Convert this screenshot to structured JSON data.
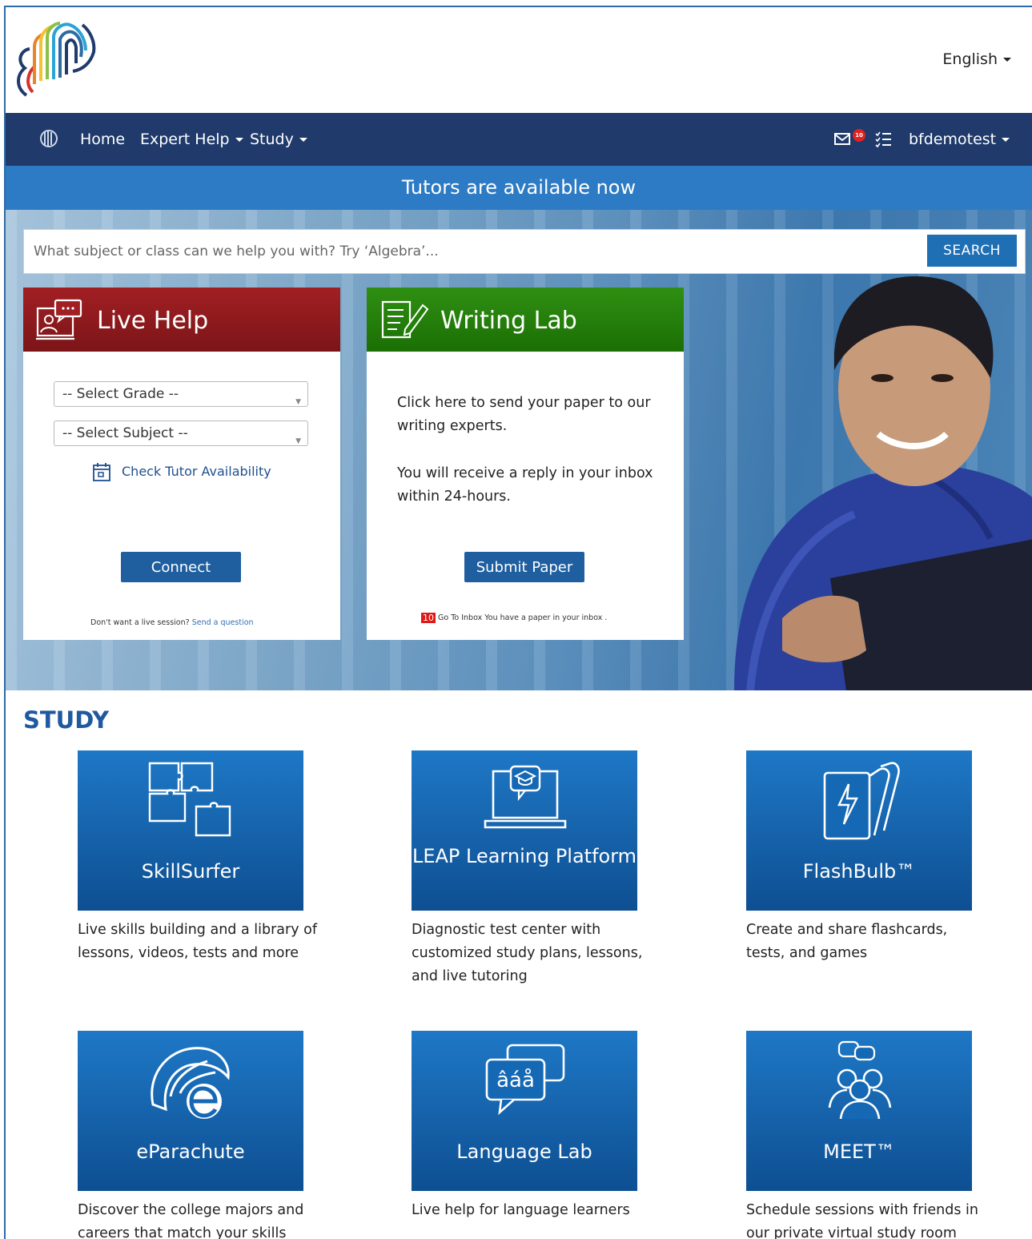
{
  "header": {
    "language": "English"
  },
  "nav": {
    "home": "Home",
    "expert_help": "Expert Help",
    "study": "Study",
    "inbox_count": "10",
    "username": "bfdemotest"
  },
  "banner": {
    "text": "Tutors are available now"
  },
  "search": {
    "placeholder": "What subject or class can we help you with? Try ‘Algebra’...",
    "button": "SEARCH"
  },
  "live_help": {
    "title": "Live Help",
    "grade_select": "-- Select Grade --",
    "subject_select": "-- Select Subject --",
    "availability_link": "Check Tutor Availability",
    "connect_button": "Connect",
    "note_prefix": "Don't want a live session?",
    "note_link": "Send a question"
  },
  "writing_lab": {
    "title": "Writing Lab",
    "text1": "Click here to send your paper to our writing experts.",
    "text2": "You will receive a reply in your inbox within 24-hours.",
    "submit_button": "Submit Paper",
    "inbox_count": "10",
    "inbox_note": "Go To Inbox You have a paper in your inbox ."
  },
  "study": {
    "title": "STUDY",
    "tiles": [
      {
        "name": "SkillSurfer",
        "desc": "Live skills building and a library of lessons, videos, tests and more",
        "icon": "puzzle-icon"
      },
      {
        "name": "LEAP Learning Platform",
        "desc": "Diagnostic test center with customized study plans, lessons, and live tutoring",
        "icon": "laptop-graduation-icon"
      },
      {
        "name": "FlashBulb™",
        "desc": "Create and share flashcards, tests, and games",
        "icon": "flashcards-icon"
      },
      {
        "name": "eParachute",
        "desc": "Discover the college majors and careers that match your skills",
        "icon": "eparachute-icon"
      },
      {
        "name": "Language Lab",
        "desc": "Live help for language learners",
        "icon": "speech-bubbles-icon"
      },
      {
        "name": "MEET™",
        "desc": "Schedule sessions with friends in our private virtual study room",
        "icon": "group-chat-icon"
      }
    ]
  },
  "colors": {
    "navbar": "#1f3a6b",
    "banner": "#2d7bc4",
    "live_help": "#8f1b1e",
    "writing_lab": "#238009",
    "tile": "#1565b0",
    "study_title": "#1f5aa0"
  }
}
